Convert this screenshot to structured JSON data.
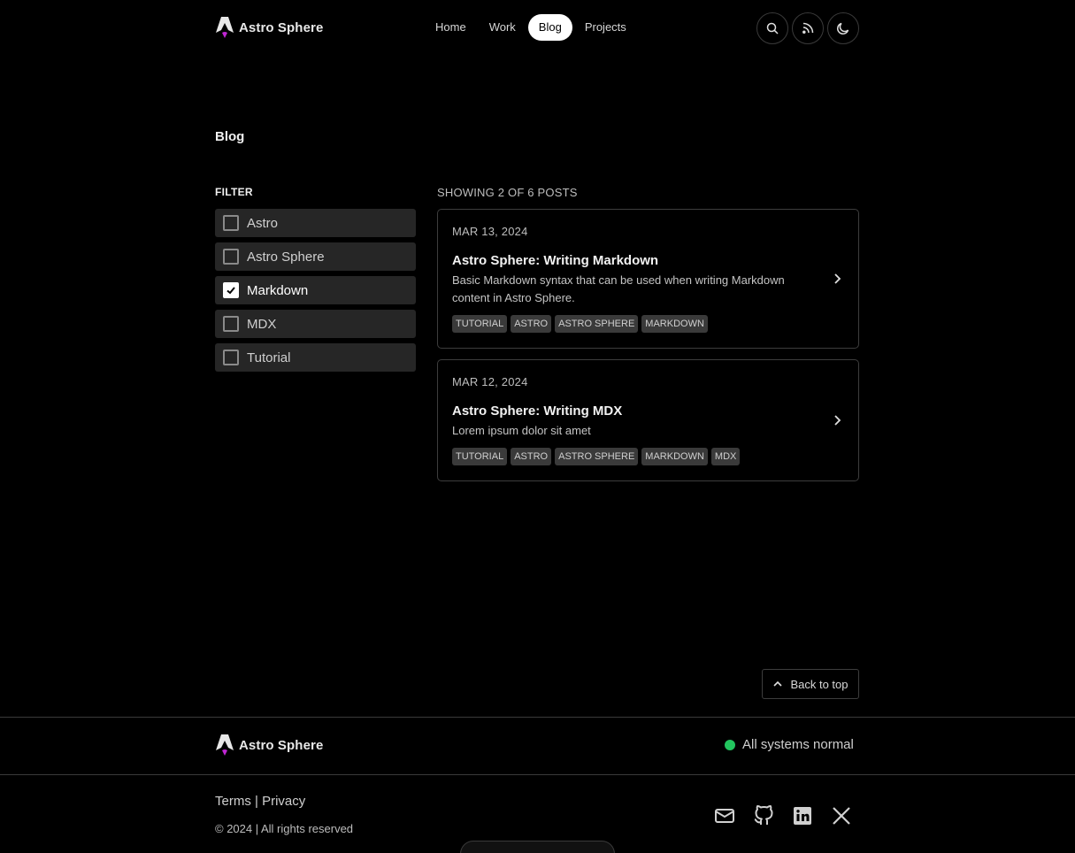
{
  "header": {
    "brand": "Astro Sphere",
    "nav": [
      "Home",
      "Work",
      "Blog",
      "Projects"
    ],
    "active_nav": "Blog",
    "buttons": [
      "search-icon",
      "rss-icon",
      "moon-icon"
    ]
  },
  "page": {
    "title": "Blog"
  },
  "filter": {
    "title": "FILTER",
    "items": [
      {
        "label": "Astro",
        "checked": false
      },
      {
        "label": "Astro Sphere",
        "checked": false
      },
      {
        "label": "Markdown",
        "checked": true
      },
      {
        "label": "MDX",
        "checked": false
      },
      {
        "label": "Tutorial",
        "checked": false
      }
    ]
  },
  "posts": {
    "showing": "SHOWING 2 OF 6 POSTS",
    "items": [
      {
        "date": "MAR 13, 2024",
        "title": "Astro Sphere: Writing Markdown",
        "description": "Basic Markdown syntax that can be used when writing Markdown content in Astro Sphere.",
        "tags": [
          "TUTORIAL",
          "ASTRO",
          "ASTRO SPHERE",
          "MARKDOWN"
        ]
      },
      {
        "date": "MAR 12, 2024",
        "title": "Astro Sphere: Writing MDX",
        "description": "Lorem ipsum dolor sit amet",
        "tags": [
          "TUTORIAL",
          "ASTRO",
          "ASTRO SPHERE",
          "MARKDOWN",
          "MDX"
        ]
      }
    ]
  },
  "back_to_top": "Back to top",
  "footer": {
    "brand": "Astro Sphere",
    "status": "All systems normal",
    "status_color": "#22c55e",
    "terms": "Terms",
    "separator": "|",
    "privacy": "Privacy",
    "copyright": "© 2024 | All rights reserved",
    "socials": [
      "mail-icon",
      "github-icon",
      "linkedin-icon",
      "x-icon"
    ]
  }
}
